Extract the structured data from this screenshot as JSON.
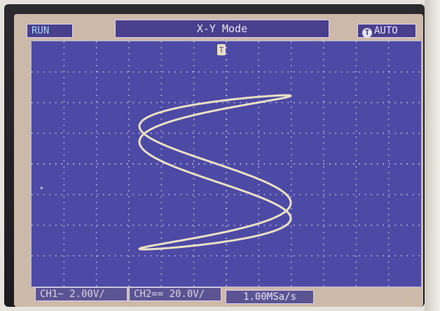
{
  "header": {
    "run_state": "RUN",
    "mode": "X-Y Mode",
    "trigger_mode": "AUTO",
    "trigger_icon_glyph": "T"
  },
  "footer": {
    "ch1": "CH1~  2.00V/",
    "ch2": "CH2==  20.0V/",
    "sample_rate": "1.00MSa/s"
  },
  "display": {
    "trace_color": "#e9e0c4",
    "grid_color": "#e9e6f7",
    "plot_bg": "#4d4aa6",
    "trigger_marker_glyph": "T"
  },
  "icons": {
    "trigger": "trigger-icon",
    "ground_marker": "ground-marker-icon",
    "trigger_position": "trigger-position-icon"
  }
}
